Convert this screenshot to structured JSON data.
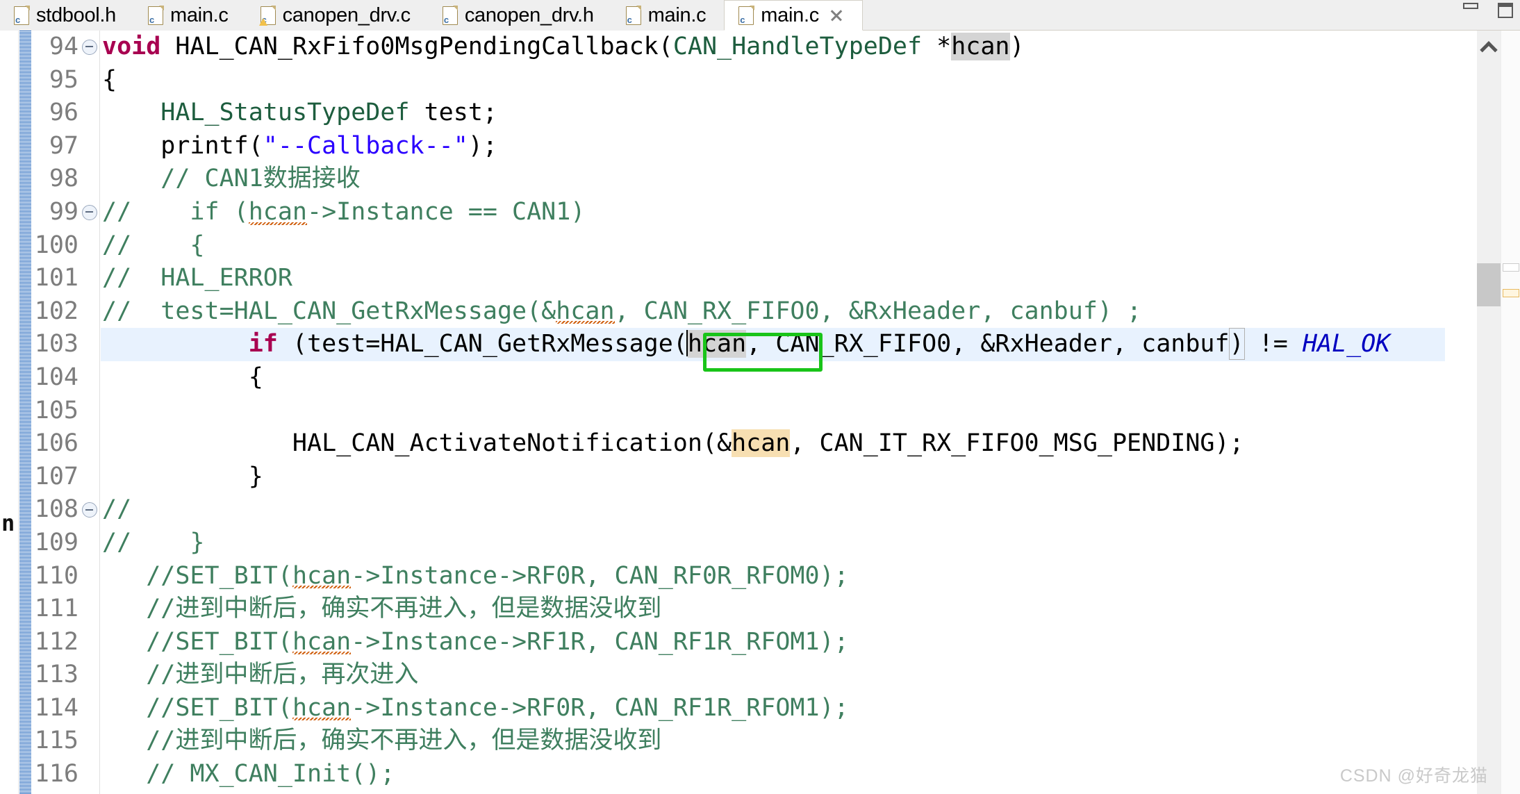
{
  "window": {
    "minimize_label": "Minimize",
    "maximize_label": "Maximize"
  },
  "tabs": [
    {
      "label": "stdbool.h",
      "icon": "c-file-icon",
      "active": false,
      "warning": false
    },
    {
      "label": "main.c",
      "icon": "c-file-icon",
      "active": false,
      "warning": false
    },
    {
      "label": "canopen_drv.c",
      "icon": "c-file-warning-icon",
      "active": false,
      "warning": true
    },
    {
      "label": "canopen_drv.h",
      "icon": "c-file-icon",
      "active": false,
      "warning": false
    },
    {
      "label": "main.c",
      "icon": "c-file-icon",
      "active": false,
      "warning": false
    },
    {
      "label": "main.c",
      "icon": "c-file-icon",
      "active": true,
      "warning": false
    }
  ],
  "editor": {
    "first_line": 94,
    "last_line": 116,
    "highlighted_line": 103,
    "fold_lines": [
      94,
      99,
      108
    ],
    "line_numbers": [
      "94",
      "95",
      "96",
      "97",
      "98",
      "99",
      "100",
      "101",
      "102",
      "103",
      "104",
      "105",
      "106",
      "107",
      "108",
      "109",
      "110",
      "111",
      "112",
      "113",
      "114",
      "115",
      "116"
    ],
    "lines": [
      {
        "n": "94",
        "text": "void HAL_CAN_RxFifo0MsgPendingCallback(CAN_HandleTypeDef *hcan)"
      },
      {
        "n": "95",
        "text": "{"
      },
      {
        "n": "96",
        "text": "    HAL_StatusTypeDef test;"
      },
      {
        "n": "97",
        "text": "    printf(\"--Callback--\");"
      },
      {
        "n": "98",
        "text": "    // CAN1数据接收"
      },
      {
        "n": "99",
        "text": "//    if (hcan->Instance == CAN1)"
      },
      {
        "n": "100",
        "text": "//    {"
      },
      {
        "n": "101",
        "text": "//  HAL_ERROR"
      },
      {
        "n": "102",
        "text": "//  test=HAL_CAN_GetRxMessage(&hcan, CAN_RX_FIFO0, &RxHeader, canbuf) ;"
      },
      {
        "n": "103",
        "text": "          if (test=HAL_CAN_GetRxMessage(hcan, CAN_RX_FIFO0, &RxHeader, canbuf) != HAL_OK"
      },
      {
        "n": "104",
        "text": "          {"
      },
      {
        "n": "105",
        "text": ""
      },
      {
        "n": "106",
        "text": "             HAL_CAN_ActivateNotification(&hcan, CAN_IT_RX_FIFO0_MSG_PENDING);"
      },
      {
        "n": "107",
        "text": "          }"
      },
      {
        "n": "108",
        "text": "//"
      },
      {
        "n": "109",
        "text": "//    }"
      },
      {
        "n": "110",
        "text": "   //SET_BIT(hcan->Instance->RF0R, CAN_RF0R_RFOM0);"
      },
      {
        "n": "111",
        "text": "   //进到中断后，确实不再进入，但是数据没收到"
      },
      {
        "n": "112",
        "text": "   //SET_BIT(hcan->Instance->RF1R, CAN_RF1R_RFOM1);"
      },
      {
        "n": "113",
        "text": "   //进到中断后，再次进入"
      },
      {
        "n": "114",
        "text": "   //SET_BIT(hcan->Instance->RF0R, CAN_RF1R_RFOM1);"
      },
      {
        "n": "115",
        "text": "   //进到中断后，确实不再进入，但是数据没收到"
      },
      {
        "n": "116",
        "text": "   // MX_CAN_Init();"
      }
    ],
    "tokens": {
      "kw_void": "void",
      "kw_if": "if",
      "fn_callback": "HAL_CAN_RxFifo0MsgPendingCallback",
      "type_can_handle": "CAN_HandleTypeDef",
      "var_hcan": "hcan",
      "type_hal_status": "HAL_StatusTypeDef",
      "var_test": "test",
      "fn_printf": "printf",
      "str_callback": "\"--Callback--\"",
      "comment_can1": "// CAN1数据接收",
      "const_hal_ok": "HAL_OK",
      "const_can_rx_fifo0": "CAN_RX_FIFO0",
      "var_rxheader": "&RxHeader",
      "var_canbuf": "canbuf",
      "fn_getrxmessage": "HAL_CAN_GetRxMessage",
      "fn_activatenotification": "HAL_CAN_ActivateNotification",
      "const_msg_pending": "CAN_IT_RX_FIFO0_MSG_PENDING"
    },
    "stray_glyph": "n"
  },
  "highlights": {
    "annotation_box_color": "#19c419",
    "occurrence_gray": "#d4d4d4",
    "occurrence_orange": "#f7dfb2",
    "current_line_bg": "#e8f2fe",
    "annotated_text": "e(hcan,"
  },
  "scrollbar": {
    "up_arrow": "scroll-up-icon",
    "thumb_label": "vertical-scroll-thumb"
  },
  "watermark": "CSDN @好奇龙猫"
}
